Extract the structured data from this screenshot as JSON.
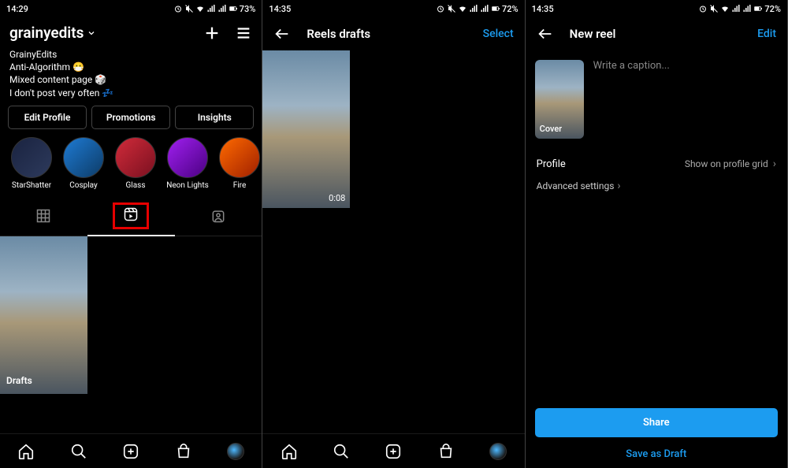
{
  "status": {
    "time_a": "14:29",
    "time_b": "14:35",
    "battery_a": "73%",
    "battery_b": "72%"
  },
  "screen1": {
    "username": "grainyedits",
    "bio": {
      "name": "GrainyEdits",
      "line2": "Anti-Algorithm 😷",
      "line3": "Mixed content page 🎲",
      "line4": "I don't post very often 💤"
    },
    "buttons": {
      "edit": "Edit Profile",
      "promo": "Promotions",
      "insights": "Insights"
    },
    "highlights": [
      {
        "label": "StarShatter",
        "bg": "linear-gradient(135deg,#1a2340,#2d3a5c)"
      },
      {
        "label": "Cosplay",
        "bg": "linear-gradient(135deg,#1e7bd4,#0d3b66)"
      },
      {
        "label": "Glass",
        "bg": "linear-gradient(135deg,#d12b3a,#7a1020)"
      },
      {
        "label": "Neon Lights",
        "bg": "linear-gradient(135deg,#a020f0,#4b0082)"
      },
      {
        "label": "Fire",
        "bg": "linear-gradient(135deg,#ff6a00,#a02000)"
      }
    ],
    "draft_label": "Drafts"
  },
  "screen2": {
    "title": "Reels drafts",
    "action": "Select",
    "reel_time": "0:08"
  },
  "screen3": {
    "title": "New reel",
    "action": "Edit",
    "cover_label": "Cover",
    "caption_placeholder": "Write a caption...",
    "profile_label": "Profile",
    "profile_value": "Show on profile grid",
    "advanced": "Advanced settings",
    "share": "Share",
    "save_draft": "Save as Draft"
  }
}
